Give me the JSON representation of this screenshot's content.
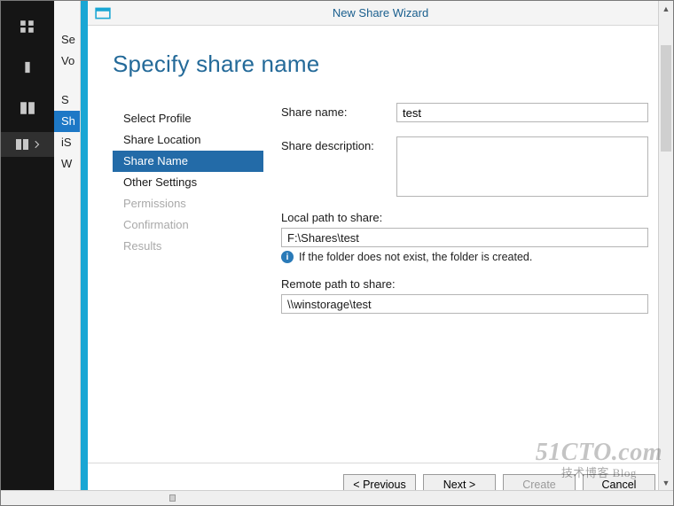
{
  "window": {
    "title": "New Share Wizard"
  },
  "page": {
    "heading": "Specify share name"
  },
  "appbar_nav": {
    "items": [
      "Se",
      "Vo",
      "S",
      "Sh",
      "iS",
      "W"
    ],
    "selected_index": 3
  },
  "steps": [
    {
      "label": "Select Profile",
      "state": "done"
    },
    {
      "label": "Share Location",
      "state": "done"
    },
    {
      "label": "Share Name",
      "state": "active"
    },
    {
      "label": "Other Settings",
      "state": "pending"
    },
    {
      "label": "Permissions",
      "state": "disabled"
    },
    {
      "label": "Confirmation",
      "state": "disabled"
    },
    {
      "label": "Results",
      "state": "disabled"
    }
  ],
  "form": {
    "share_name_label": "Share name:",
    "share_name_value": "test",
    "share_desc_label": "Share description:",
    "share_desc_value": "",
    "local_path_label": "Local path to share:",
    "local_path_value": "F:\\Shares\\test",
    "local_path_note": "If the folder does not exist, the folder is created.",
    "remote_path_label": "Remote path to share:",
    "remote_path_value": "\\\\winstorage\\test"
  },
  "buttons": {
    "previous": "< Previous",
    "next": "Next >",
    "create": "Create",
    "cancel": "Cancel"
  },
  "watermark": {
    "line1": "51CTO.com",
    "line2": "技术博客   Blog"
  }
}
